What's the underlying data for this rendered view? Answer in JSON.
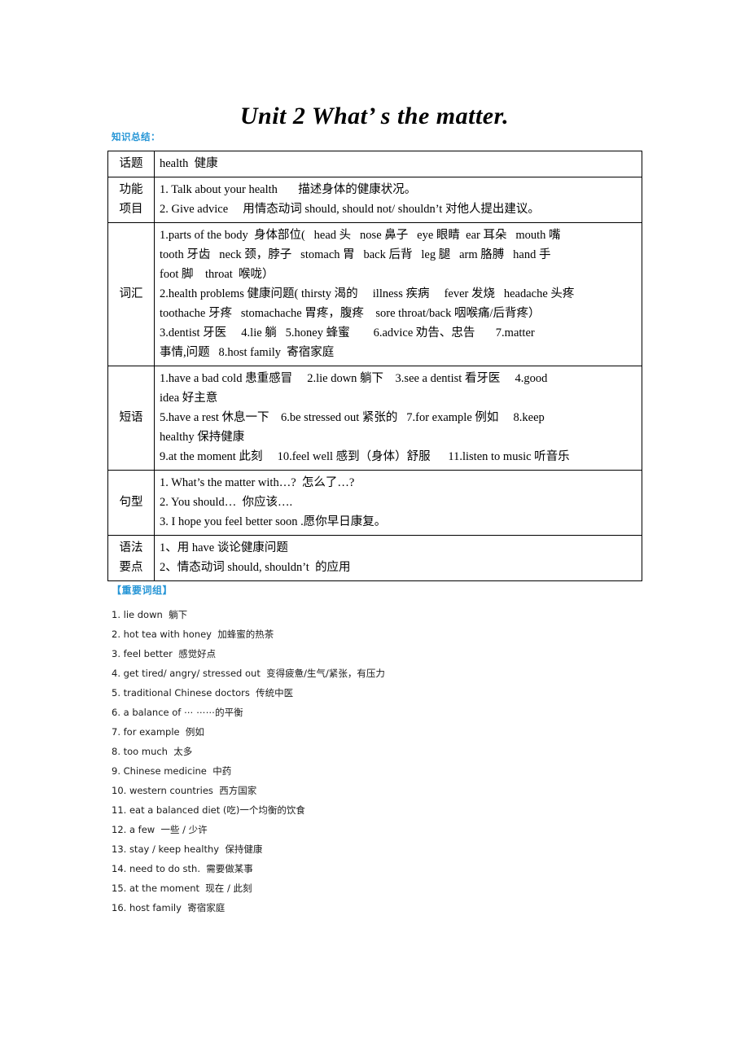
{
  "document": {
    "title": "Unit 2 What’ s the matter."
  },
  "headings": {
    "knowledge_summary": "知识总结：",
    "important_phrases": "【重要词组】"
  },
  "summary_table": {
    "rows": [
      {
        "label_lines": [
          "话题"
        ],
        "content_lines": [
          "health  健康"
        ]
      },
      {
        "label_lines": [
          "功能",
          "项目"
        ],
        "content_lines": [
          "1. Talk about your health       描述身体的健康状况。",
          "2. Give advice     用情态动词 should, should not/ shouldn’t 对他人提出建议。"
        ]
      },
      {
        "label_lines": [
          "词汇"
        ],
        "content_lines": [
          "1.parts of the body  身体部位(   head 头   nose 鼻子   eye 眼睛  ear 耳朵   mouth 嘴",
          "tooth 牙齿   neck 颈，脖子   stomach 胃   back 后背   leg 腿   arm 胳膊   hand 手",
          "foot 脚    throat  喉咙）",
          "2.health problems 健康问题( thirsty 渴的     illness 疾病     fever 发烧   headache 头疼",
          "toothache 牙疼   stomachache 胃疼，腹疼    sore throat/back 咽喉痛/后背疼）",
          "3.dentist 牙医     4.lie 躺   5.honey 蜂蜜        6.advice 劝告、忠告       7.matter",
          "事情,问题   8.host family  寄宿家庭"
        ]
      },
      {
        "label_lines": [
          "短语"
        ],
        "content_lines": [
          "1.have a bad cold 患重感冒     2.lie down 躺下    3.see a dentist 看牙医     4.good",
          "idea 好主意",
          "5.have a rest 休息一下    6.be stressed out 紧张的   7.for example 例如     8.keep",
          "healthy 保持健康",
          "9.at the moment 此刻     10.feel well 感到（身体）舒服      11.listen to music 听音乐"
        ]
      },
      {
        "label_lines": [
          "句型"
        ],
        "content_lines": [
          "1. What’s the matter with…?  怎么了…?",
          "2. You should…  你应该….",
          "3. I hope you feel better soon .愿你早日康复。"
        ]
      },
      {
        "label_lines": [
          "语法",
          "要点"
        ],
        "content_lines": [
          "1、用 have 谈论健康问题",
          "2、情态动词 should, shouldn’t  的应用"
        ]
      }
    ]
  },
  "phrase_list": {
    "items": [
      "1. lie down  躺下",
      "2. hot tea with honey  加蜂蜜的热茶",
      "3. feel better  感觉好点",
      "4. get tired/ angry/ stressed out  变得疲惫/生气/紧张，有压力",
      "5. traditional Chinese doctors  传统中医",
      "6. a balance of ⋯ ⋯⋯的平衡",
      "7. for example  例如",
      "8. too much  太多",
      "9. Chinese medicine  中药",
      "10. western countries  西方国家",
      "11. eat a balanced diet (吃)一个均衡的饮食",
      "12. a few  一些 / 少许",
      "13. stay / keep healthy  保持健康",
      "14. need to do sth.  需要做某事",
      "15. at the moment  现在 / 此刻",
      "16. host family  寄宿家庭"
    ]
  },
  "colors": {
    "heading_blue": "#2595d6",
    "text_black": "#000000",
    "table_border": "#000000"
  }
}
